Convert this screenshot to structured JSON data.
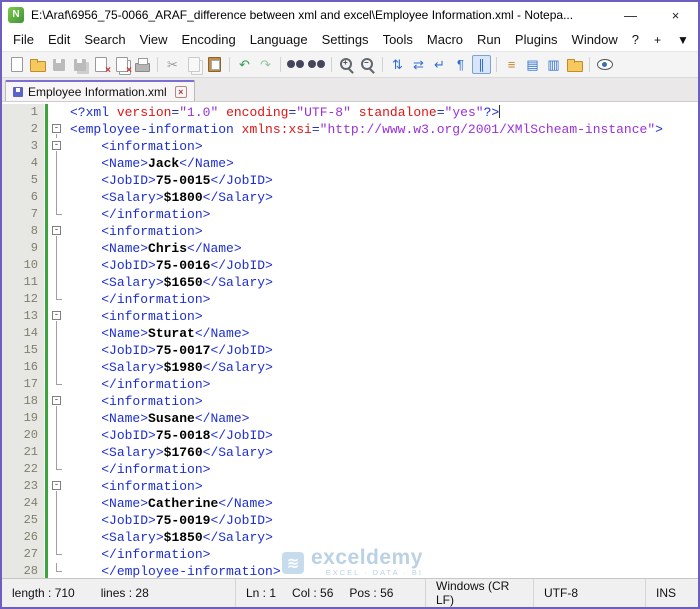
{
  "window": {
    "title": "E:\\Araf\\6956_75-0066_ARAF_difference between xml and excel\\Employee Information.xml - Notepa...",
    "app_icon_letter": "N",
    "minimize_glyph": "—",
    "close_glyph": "×"
  },
  "menu": {
    "items": [
      "File",
      "Edit",
      "Search",
      "View",
      "Encoding",
      "Language",
      "Settings",
      "Tools",
      "Macro",
      "Run",
      "Plugins",
      "Window",
      "?"
    ],
    "plus": "+",
    "arrow": "▼"
  },
  "toolbar": [
    {
      "name": "new-file-icon",
      "cls": "sh-page"
    },
    {
      "name": "open-file-icon",
      "cls": "sh-folder"
    },
    {
      "name": "save-icon",
      "cls": "sh-floppy dis"
    },
    {
      "name": "save-all-icon",
      "cls": "sh-floppy multi dis"
    },
    {
      "name": "close-icon",
      "cls": "sh-page x-mark"
    },
    {
      "name": "close-all-icon",
      "cls": "sh-page multi x-mark"
    },
    {
      "name": "print-icon",
      "cls": "sh-printer"
    },
    {
      "sep": true
    },
    {
      "name": "cut-icon",
      "ch": "✂",
      "c": "#9a9a9a"
    },
    {
      "name": "copy-icon",
      "cls": "sh-page multi dis"
    },
    {
      "name": "paste-icon",
      "cls": "sh-clip"
    },
    {
      "sep": true
    },
    {
      "name": "undo-icon",
      "ch": "↶",
      "c": "#2f9e4f"
    },
    {
      "name": "redo-icon",
      "ch": "↷",
      "c": "#8fc7a0"
    },
    {
      "sep": true
    },
    {
      "name": "find-icon",
      "cls": "sh-binoc"
    },
    {
      "name": "replace-icon",
      "cls": "sh-binoc"
    },
    {
      "sep": true
    },
    {
      "name": "zoom-in-icon",
      "cls": "sh-mag",
      "ch": "+"
    },
    {
      "name": "zoom-out-icon",
      "cls": "sh-mag",
      "ch": "−"
    },
    {
      "sep": true
    },
    {
      "name": "sync-vertical-scroll-icon",
      "ch": "⇅",
      "c": "#2f6fd0"
    },
    {
      "name": "sync-horizontal-scroll-icon",
      "ch": "⇄",
      "c": "#2f6fd0"
    },
    {
      "name": "word-wrap-icon",
      "ch": "↵",
      "c": "#2f6fd0"
    },
    {
      "name": "show-all-characters-icon",
      "ch": "¶",
      "c": "#2f6fd0"
    },
    {
      "name": "show-indent-guide-icon",
      "ch": "∥",
      "c": "#2f6fd0",
      "pressed": true
    },
    {
      "sep": true
    },
    {
      "name": "function-list-icon",
      "ch": "≡",
      "c": "#c8822a"
    },
    {
      "name": "document-map-icon",
      "ch": "▤",
      "c": "#2f6fd0"
    },
    {
      "name": "document-list-icon",
      "ch": "▥",
      "c": "#2f6fd0"
    },
    {
      "name": "folder-as-workspace-icon",
      "cls": "sh-folder"
    },
    {
      "sep": true
    },
    {
      "name": "monitoring-icon",
      "cls": "sh-eye"
    }
  ],
  "tab": {
    "label": "Employee Information.xml",
    "close_glyph": "×"
  },
  "code": {
    "fold_glyph": "-",
    "lines": [
      {
        "n": 1,
        "fold": "",
        "ind": 0,
        "caret": true,
        "t": [
          [
            "<?xml ",
            "tag"
          ],
          [
            "version",
            "attr"
          ],
          [
            "=",
            "eq"
          ],
          [
            "\"1.0\"",
            "val"
          ],
          [
            " ",
            "pl"
          ],
          [
            "encoding",
            "attr"
          ],
          [
            "=",
            "eq"
          ],
          [
            "\"UTF-8\"",
            "val"
          ],
          [
            " ",
            "pl"
          ],
          [
            "standalone",
            "attr"
          ],
          [
            "=",
            "eq"
          ],
          [
            "\"yes\"",
            "val"
          ],
          [
            "?>",
            "tag"
          ]
        ]
      },
      {
        "n": 2,
        "fold": "start",
        "ind": 0,
        "t": [
          [
            "<employee-information ",
            "tag"
          ],
          [
            "xmlns:xsi",
            "attr"
          ],
          [
            "=",
            "eq"
          ],
          [
            "\"http://www.w3.org/2001/XMlScheam-instance\"",
            "val"
          ],
          [
            ">",
            "tag"
          ]
        ]
      },
      {
        "n": 3,
        "fold": "start",
        "ind": 4,
        "t": [
          [
            "<information>",
            "tag"
          ]
        ]
      },
      {
        "n": 4,
        "fold": "line",
        "ind": 4,
        "t": [
          [
            "<Name>",
            "tag"
          ],
          [
            "Jack",
            "txt"
          ],
          [
            "</Name>",
            "tag"
          ]
        ]
      },
      {
        "n": 5,
        "fold": "line",
        "ind": 4,
        "t": [
          [
            "<JobID>",
            "tag"
          ],
          [
            "75-0015",
            "txt"
          ],
          [
            "</JobID>",
            "tag"
          ]
        ]
      },
      {
        "n": 6,
        "fold": "line",
        "ind": 4,
        "t": [
          [
            "<Salary>",
            "tag"
          ],
          [
            "$1800",
            "txt"
          ],
          [
            "</Salary>",
            "tag"
          ]
        ]
      },
      {
        "n": 7,
        "fold": "end",
        "ind": 4,
        "t": [
          [
            "</information>",
            "tag"
          ]
        ]
      },
      {
        "n": 8,
        "fold": "start",
        "ind": 4,
        "t": [
          [
            "<information>",
            "tag"
          ]
        ]
      },
      {
        "n": 9,
        "fold": "line",
        "ind": 4,
        "t": [
          [
            "<Name>",
            "tag"
          ],
          [
            "Chris",
            "txt"
          ],
          [
            "</Name>",
            "tag"
          ]
        ]
      },
      {
        "n": 10,
        "fold": "line",
        "ind": 4,
        "t": [
          [
            "<JobID>",
            "tag"
          ],
          [
            "75-0016",
            "txt"
          ],
          [
            "</JobID>",
            "tag"
          ]
        ]
      },
      {
        "n": 11,
        "fold": "line",
        "ind": 4,
        "t": [
          [
            "<Salary>",
            "tag"
          ],
          [
            "$1650",
            "txt"
          ],
          [
            "</Salary>",
            "tag"
          ]
        ]
      },
      {
        "n": 12,
        "fold": "end",
        "ind": 4,
        "t": [
          [
            "</information>",
            "tag"
          ]
        ]
      },
      {
        "n": 13,
        "fold": "start",
        "ind": 4,
        "t": [
          [
            "<information>",
            "tag"
          ]
        ]
      },
      {
        "n": 14,
        "fold": "line",
        "ind": 4,
        "t": [
          [
            "<Name>",
            "tag"
          ],
          [
            "Sturat",
            "txt"
          ],
          [
            "</Name>",
            "tag"
          ]
        ]
      },
      {
        "n": 15,
        "fold": "line",
        "ind": 4,
        "t": [
          [
            "<JobID>",
            "tag"
          ],
          [
            "75-0017",
            "txt"
          ],
          [
            "</JobID>",
            "tag"
          ]
        ]
      },
      {
        "n": 16,
        "fold": "line",
        "ind": 4,
        "t": [
          [
            "<Salary>",
            "tag"
          ],
          [
            "$1980",
            "txt"
          ],
          [
            "</Salary>",
            "tag"
          ]
        ]
      },
      {
        "n": 17,
        "fold": "end",
        "ind": 4,
        "t": [
          [
            "</information>",
            "tag"
          ]
        ]
      },
      {
        "n": 18,
        "fold": "start",
        "ind": 4,
        "t": [
          [
            "<information>",
            "tag"
          ]
        ]
      },
      {
        "n": 19,
        "fold": "line",
        "ind": 4,
        "t": [
          [
            "<Name>",
            "tag"
          ],
          [
            "Susane",
            "txt"
          ],
          [
            "</Name>",
            "tag"
          ]
        ]
      },
      {
        "n": 20,
        "fold": "line",
        "ind": 4,
        "t": [
          [
            "<JobID>",
            "tag"
          ],
          [
            "75-0018",
            "txt"
          ],
          [
            "</JobID>",
            "tag"
          ]
        ]
      },
      {
        "n": 21,
        "fold": "line",
        "ind": 4,
        "t": [
          [
            "<Salary>",
            "tag"
          ],
          [
            "$1760",
            "txt"
          ],
          [
            "</Salary>",
            "tag"
          ]
        ]
      },
      {
        "n": 22,
        "fold": "end",
        "ind": 4,
        "t": [
          [
            "</information>",
            "tag"
          ]
        ]
      },
      {
        "n": 23,
        "fold": "start",
        "ind": 4,
        "t": [
          [
            "<information>",
            "tag"
          ]
        ]
      },
      {
        "n": 24,
        "fold": "line",
        "ind": 4,
        "t": [
          [
            "<Name>",
            "tag"
          ],
          [
            "Catherine",
            "txt"
          ],
          [
            "</Name>",
            "tag"
          ]
        ]
      },
      {
        "n": 25,
        "fold": "line",
        "ind": 4,
        "t": [
          [
            "<JobID>",
            "tag"
          ],
          [
            "75-0019",
            "txt"
          ],
          [
            "</JobID>",
            "tag"
          ]
        ]
      },
      {
        "n": 26,
        "fold": "line",
        "ind": 4,
        "t": [
          [
            "<Salary>",
            "tag"
          ],
          [
            "$1850",
            "txt"
          ],
          [
            "</Salary>",
            "tag"
          ]
        ]
      },
      {
        "n": 27,
        "fold": "end",
        "ind": 4,
        "t": [
          [
            "</information>",
            "tag"
          ]
        ]
      },
      {
        "n": 28,
        "fold": "end",
        "ind": 4,
        "t": [
          [
            "</employee-information>",
            "tag"
          ]
        ]
      }
    ]
  },
  "status": {
    "length": "length : 710",
    "lines": "lines : 28",
    "ln": "Ln : 1",
    "col": "Col : 56",
    "pos": "Pos : 56",
    "eol": "Windows (CR LF)",
    "encoding": "UTF-8",
    "mode": "INS"
  },
  "watermark": {
    "logo_glyph": "≋",
    "name": "exceldemy",
    "tagline": "EXCEL · DATA · BI"
  },
  "colors": {
    "accent_border": "#6e5ec2",
    "tag": "#1d2ed2",
    "attribute": "#e01414",
    "value": "#9b30d8",
    "content_text": "#000000",
    "change_marker": "#3da53d",
    "line_number": "#7f7f6e"
  }
}
